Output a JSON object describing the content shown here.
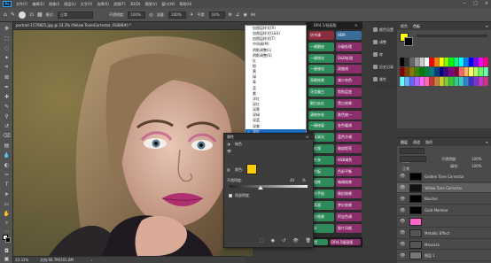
{
  "menubar": {
    "logo": "Ps",
    "items": [
      "文件(F)",
      "编辑(E)",
      "图像(I)",
      "图层(L)",
      "文字(Y)",
      "选择(S)",
      "滤镜(T)",
      "3D(D)",
      "视图(V)",
      "窗口(W)",
      "帮助(H)"
    ]
  },
  "options": {
    "mode_label": "模式:",
    "mode_value": "正常",
    "opacity_label": "不透明度:",
    "opacity_value": "100%",
    "flow_label": "流量:",
    "flow_value": "100%",
    "smooth_label": "平滑:",
    "smooth_value": "10%",
    "brush_size": "15"
  },
  "document": {
    "tab_title": "portrait-1579825.jpg @ 33.3% (Yellow Tone Corrector, RGB/8#) *",
    "zoom": "33.33%",
    "doc_size": "文档:66.7M/301.8M"
  },
  "dropdown": {
    "selected_index": 19,
    "items": [
      "加图层样式(R)",
      "加图层样式(L&S)",
      "加图层样式(T)",
      "中间调(M)",
      "阴影调整(L)",
      "阴影调整(S)",
      "红",
      "橙",
      "黄",
      "绿",
      "青",
      "蓝",
      "紫",
      "洋红",
      "深红",
      "深黄",
      "深绿",
      "深蓝",
      "深紫",
      "洋红",
      "浅黄",
      "水平"
    ]
  },
  "plugin": {
    "title": "DR4.5/插画版",
    "buttons": [
      {
        "label": "仿书清",
        "color": "#8a2e3c"
      },
      {
        "label": "HDR",
        "color": "#3a6c9a"
      },
      {
        "label": "一键磨皮",
        "color": "#2f8a59"
      },
      {
        "label": "分级处理",
        "color": "#8a2e6c"
      },
      {
        "label": "一键锐化",
        "color": "#2f8a59"
      },
      {
        "label": "D&B处理",
        "color": "#8a2e6c"
      },
      {
        "label": "一键液化",
        "color": "#2f8a59"
      },
      {
        "label": "双曲线",
        "color": "#8a2e6c"
      },
      {
        "label": "亮眼效果",
        "color": "#2f8a59"
      },
      {
        "label": "减少杂色",
        "color": "#8a2e6c"
      },
      {
        "label": "牙齿美白",
        "color": "#2f8a59"
      },
      {
        "label": "剪贴层变",
        "color": "#8a2e6c"
      },
      {
        "label": "眼白去红",
        "color": "#2f8a59"
      },
      {
        "label": "黑白效果",
        "color": "#8a2e6c"
      },
      {
        "label": "清除杂毛",
        "color": "#2f8a59"
      },
      {
        "label": "肤色统一",
        "color": "#8a2e6c"
      },
      {
        "label": "一键修复",
        "color": "#2f8a59"
      },
      {
        "label": "金色暖调",
        "color": "#8a2e6c"
      },
      {
        "label": "修复高光",
        "color": "#2f8a59"
      },
      {
        "label": "蓝色冷调",
        "color": "#8a2e6c"
      },
      {
        "label": "高低频",
        "color": "#2f8a59"
      },
      {
        "label": "暗部提亮",
        "color": "#8a2e6c"
      },
      {
        "label": "中性灰",
        "color": "#2f8a59"
      },
      {
        "label": "HSB调色",
        "color": "#8a2e6c"
      },
      {
        "label": "调色板",
        "color": "#2f8a59"
      },
      {
        "label": "色彩平衡",
        "color": "#8a2e6c"
      },
      {
        "label": "滤镜库",
        "color": "#2f8a59"
      },
      {
        "label": "暗调效果",
        "color": "#8a2e6c"
      },
      {
        "label": "制作手绘",
        "color": "#2f8a59"
      },
      {
        "label": "做旧效果",
        "color": "#8a2e6c"
      },
      {
        "label": "像素画",
        "color": "#2f8a59"
      },
      {
        "label": "梦幻效果",
        "color": "#8a2e6c"
      },
      {
        "label": "复古效果",
        "color": "#2f8a59"
      },
      {
        "label": "阿宝色调",
        "color": "#8a2e6c"
      },
      {
        "label": "炫彩",
        "color": "#2f8a59"
      },
      {
        "label": "胶片风格",
        "color": "#8a2e6c"
      }
    ],
    "bottom": [
      {
        "label": "设置",
        "color": "#2f8a59"
      },
      {
        "label": "DR4.5插画版",
        "color": "#8a2e6c"
      }
    ]
  },
  "properties": {
    "title": "属性",
    "subtitle": "纯色",
    "color_label": "颜色:",
    "opacity_label": "不透明度:",
    "opacity_value": "40",
    "opacity_unit": "%",
    "checkbox_label": "保留明度",
    "fill_color": "#ffcc00",
    "slider_fraction": 0.4
  },
  "rightcol": {
    "items": [
      "颜色设置",
      "调整",
      "库",
      "历史记录",
      "属性"
    ]
  },
  "swatches": {
    "tabs": [
      "颜色",
      "色板"
    ],
    "colors": [
      "#000000",
      "#333333",
      "#666666",
      "#999999",
      "#cccccc",
      "#ffffff",
      "#ff0000",
      "#ff8000",
      "#ffff00",
      "#80ff00",
      "#00ff00",
      "#00ff80",
      "#00ffff",
      "#0080ff",
      "#0000ff",
      "#8000ff",
      "#ff00ff",
      "#ff0080",
      "#800000",
      "#804000",
      "#808000",
      "#408000",
      "#008000",
      "#008040",
      "#008080",
      "#004080",
      "#000080",
      "#400080",
      "#800080",
      "#800040",
      "#ff6666",
      "#ffb366",
      "#ffff66",
      "#b3ff66",
      "#66ff66",
      "#66ffb3",
      "#66ffff",
      "#66b3ff",
      "#6666ff",
      "#b366ff",
      "#ff66ff",
      "#ff66b3",
      "#cc3333",
      "#cc8033",
      "#cccc33",
      "#80cc33",
      "#33cc33",
      "#33cc80",
      "#33cccc",
      "#3380cc",
      "#3333cc",
      "#8033cc",
      "#cc33cc",
      "#cc3380"
    ]
  },
  "layers": {
    "tabs": [
      "图层",
      "通道",
      "路径"
    ],
    "kind_label": "类型",
    "blend_mode": "正常",
    "opacity_label": "不透明度:",
    "opacity_value": "100%",
    "fill_label": "填充:",
    "fill_value": "100%",
    "items": [
      {
        "name": "Golden Tone Corrector",
        "thumb": "#000000",
        "selected": false
      },
      {
        "name": "Yellow Tone Corrector",
        "thumb": "#111111",
        "selected": true
      },
      {
        "name": "Blusher",
        "thumb": "#000000",
        "selected": false
      },
      {
        "name": "Gold Member",
        "thumb": "#000000",
        "selected": false
      },
      {
        "name": "",
        "thumb": "#ff66cc",
        "selected": false
      },
      {
        "name": "Metallic Effect",
        "thumb": "#555555",
        "selected": false
      },
      {
        "name": "Mascara",
        "thumb": "#555555",
        "selected": false
      },
      {
        "name": "图层 1",
        "thumb": "#777777",
        "selected": false
      }
    ]
  }
}
